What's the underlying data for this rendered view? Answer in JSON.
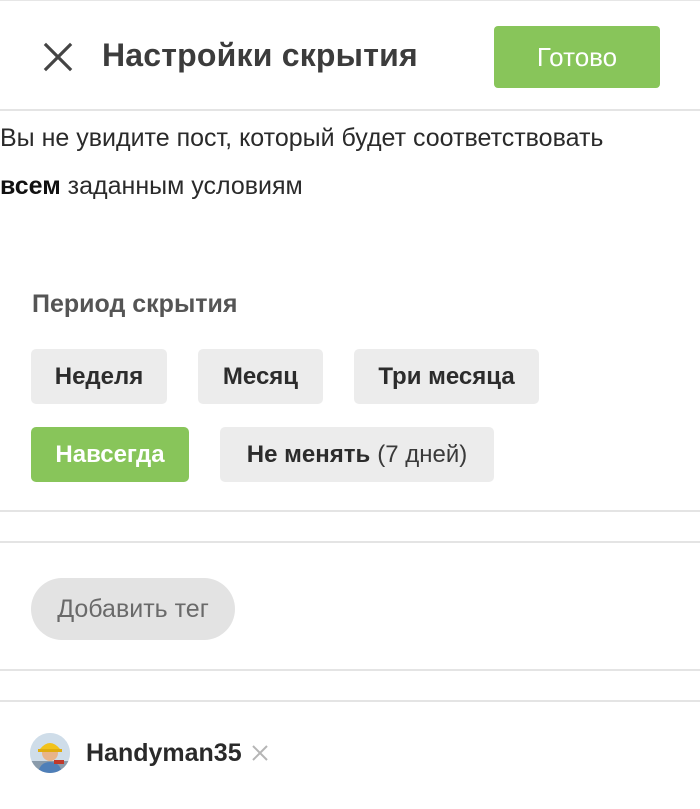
{
  "header": {
    "title": "Настройки скрытия",
    "done_label": "Готово",
    "close_icon": "close-icon"
  },
  "description": {
    "line1": "Вы не увидите пост, который будет соответствовать",
    "bold_word": "всем",
    "line2_rest": " заданным условиям"
  },
  "period": {
    "title": "Период скрытия",
    "options": [
      {
        "label": "Неделя",
        "selected": false
      },
      {
        "label": "Месяц",
        "selected": false
      },
      {
        "label": "Три месяца",
        "selected": false
      },
      {
        "label": "Навсегда",
        "selected": true
      }
    ],
    "keep": {
      "label": "Не менять",
      "hint": "(7 дней)",
      "selected": false
    }
  },
  "tags": {
    "add_label": "Добавить тег"
  },
  "users": [
    {
      "name": "Handyman35",
      "remove_icon": "close-icon"
    }
  ],
  "colors": {
    "accent": "#88c55a",
    "chip_bg": "#ececec",
    "divider": "#e4e4e4"
  }
}
